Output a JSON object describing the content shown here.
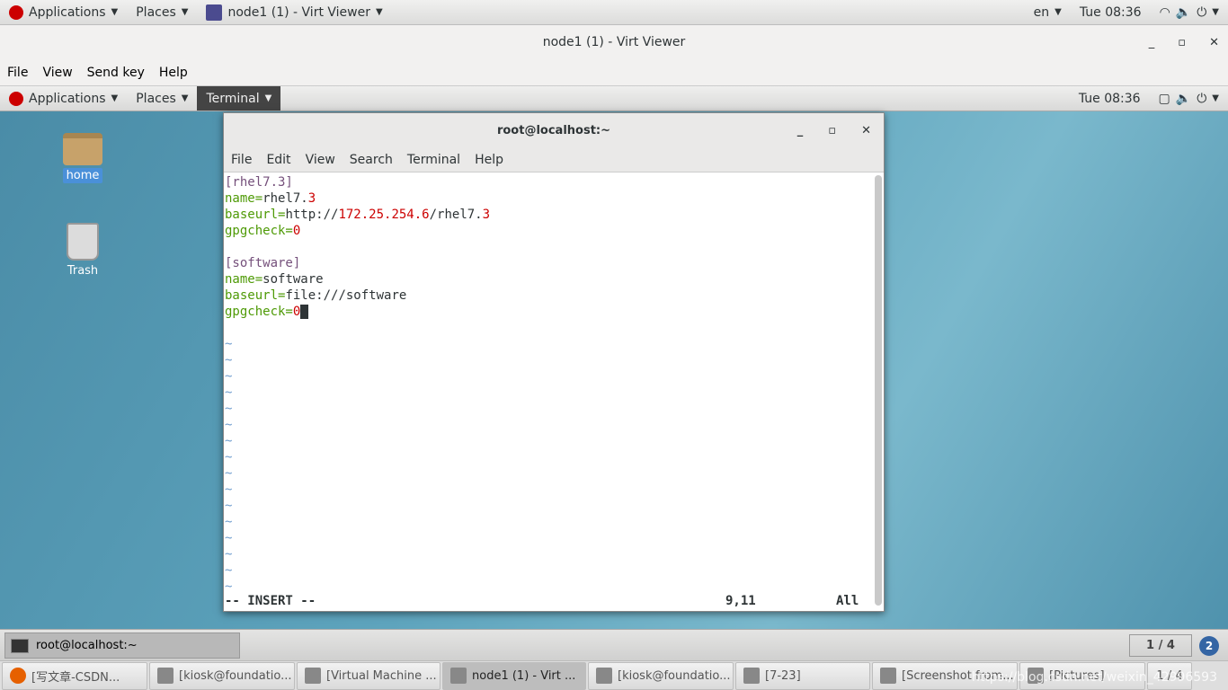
{
  "host_top": {
    "applications": "Applications",
    "places": "Places",
    "window": "node1 (1) - Virt Viewer",
    "lang": "en",
    "clock": "Tue 08:36"
  },
  "viewer": {
    "title": "node1 (1) - Virt Viewer",
    "menu": [
      "File",
      "View",
      "Send key",
      "Help"
    ]
  },
  "guest_top": {
    "applications": "Applications",
    "places": "Places",
    "window": "Terminal",
    "clock": "Tue 08:36"
  },
  "desktop": {
    "icons": [
      "home",
      "Trash"
    ]
  },
  "terminal": {
    "title": "root@localhost:~",
    "menu": [
      "File",
      "Edit",
      "View",
      "Search",
      "Terminal",
      "Help"
    ],
    "status": {
      "mode": "-- INSERT --",
      "pos": "9,11",
      "scroll": "All"
    },
    "tilde": "~"
  },
  "guest_bottom": {
    "task": "root@localhost:~",
    "pager": "1 / 4",
    "workspace": "2"
  },
  "host_taskbar": {
    "items": [
      "[写文章-CSDN...",
      "[kiosk@foundatio...",
      "[Virtual Machine ...",
      "node1 (1) - Virt ...",
      "[kiosk@foundatio...",
      "[7-23]",
      "[Screenshot from...",
      "[Pictures]"
    ],
    "pager": "1 / 4"
  },
  "watermark": "https://blog.csdn.net/weixin_42996593"
}
